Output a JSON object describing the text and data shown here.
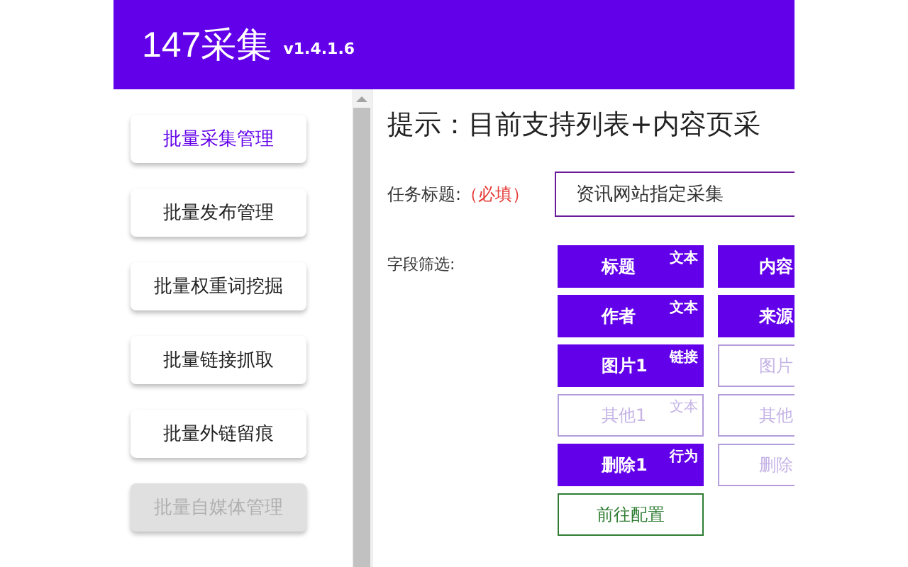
{
  "header": {
    "title": "147采集",
    "version": "v1.4.1.6"
  },
  "sidebar": {
    "items": [
      {
        "label": "批量采集管理",
        "selected": true,
        "disabled": false
      },
      {
        "label": "批量发布管理",
        "selected": false,
        "disabled": false
      },
      {
        "label": "批量权重词挖掘",
        "selected": false,
        "disabled": false
      },
      {
        "label": "批量链接抓取",
        "selected": false,
        "disabled": false
      },
      {
        "label": "批量外链留痕",
        "selected": false,
        "disabled": false
      },
      {
        "label": "批量自媒体管理",
        "selected": false,
        "disabled": true
      }
    ]
  },
  "content": {
    "tip": "提示：目前支持列表+内容页采",
    "task_title": {
      "label": "任务标题:",
      "required": "（必填）",
      "value": "资讯网站指定采集"
    },
    "fields": {
      "label": "字段筛选:",
      "chips": [
        {
          "label": "标题",
          "tag": "文本",
          "selected": true
        },
        {
          "label": "内容",
          "selected": true
        },
        {
          "label": "作者",
          "tag": "文本",
          "selected": true
        },
        {
          "label": "来源",
          "selected": true
        },
        {
          "label": "图片1",
          "tag": "链接",
          "selected": true
        },
        {
          "label": "图片",
          "selected": false
        },
        {
          "label": "其他1",
          "tag": "文本",
          "selected": false
        },
        {
          "label": "其他",
          "selected": false
        },
        {
          "label": "删除1",
          "tag": "行为",
          "selected": true
        },
        {
          "label": "删除",
          "selected": false
        }
      ]
    },
    "configure_button": "前往配置"
  }
}
